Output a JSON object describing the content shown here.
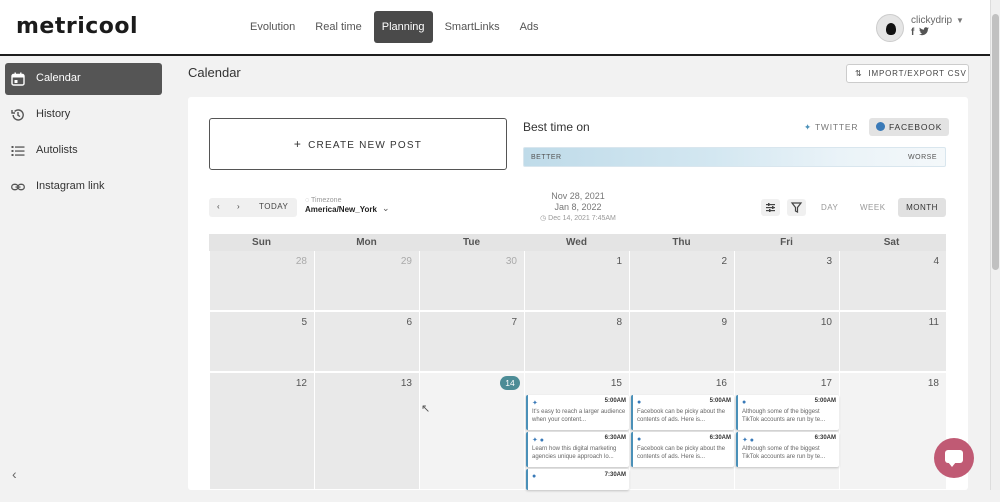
{
  "logo": "metricool",
  "nav": [
    "Evolution",
    "Real time",
    "Planning",
    "SmartLinks",
    "Ads"
  ],
  "user": {
    "name": "clickydrip",
    "socials": "f"
  },
  "sidebar": {
    "items": [
      {
        "label": "Calendar",
        "icon": "calendar-icon"
      },
      {
        "label": "History",
        "icon": "history-icon"
      },
      {
        "label": "Autolists",
        "icon": "list-icon"
      },
      {
        "label": "Instagram link",
        "icon": "link-icon"
      }
    ],
    "collapse": "‹"
  },
  "page": {
    "title": "Calendar",
    "import_label": "IMPORT/EXPORT CSV"
  },
  "panel": {
    "create_label": "CREATE NEW POST",
    "best_time": "Best time on",
    "networks": [
      "TWITTER",
      "FACEBOOK"
    ],
    "better": "BETTER",
    "worse": "WORSE"
  },
  "calnav": {
    "prev": "‹",
    "next": "›",
    "today": "TODAY"
  },
  "timezone": {
    "label": "Timezone",
    "value": "America/New_York"
  },
  "range": {
    "start": "Nov 28, 2021",
    "end": "Jan 8, 2022",
    "updated": "Dec 14, 2021 7:45AM"
  },
  "views": [
    "DAY",
    "WEEK",
    "MONTH"
  ],
  "weekdays": [
    "Sun",
    "Mon",
    "Tue",
    "Wed",
    "Thu",
    "Fri",
    "Sat"
  ],
  "rows": [
    [
      "28",
      "29",
      "30",
      "1",
      "2",
      "3",
      "4"
    ],
    [
      "5",
      "6",
      "7",
      "8",
      "9",
      "10",
      "11"
    ],
    [
      "12",
      "13",
      "14",
      "15",
      "16",
      "17",
      "18"
    ]
  ],
  "posts": [
    {
      "time": "5:00AM",
      "text": "It's easy to reach a larger audience when your content..."
    },
    {
      "time": "5:00AM",
      "text": "Facebook can be picky about the contents of ads. Here is..."
    },
    {
      "time": "5:00AM",
      "text": "Although some of the biggest TikTok accounts are run by te..."
    },
    {
      "time": "6:30AM",
      "text": "Learn how this digital marketing agencies unique approach lo..."
    },
    {
      "time": "6:30AM",
      "text": "Facebook can be picky about the contents of ads. Here is..."
    },
    {
      "time": "6:30AM",
      "text": "Although some of the biggest TikTok accounts are run by te..."
    },
    {
      "time": "7:30AM",
      "text": ""
    }
  ],
  "colors": {
    "accent": "#4c8c96",
    "chat": "#c05a74",
    "twitter": "#4a90b8"
  }
}
